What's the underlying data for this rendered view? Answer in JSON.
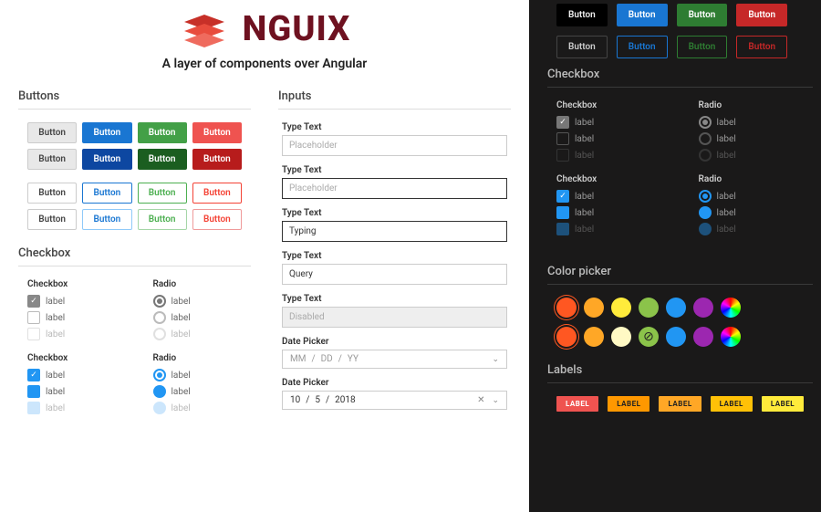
{
  "hero": {
    "brand": "NGUIX",
    "tagline": "A layer of components over Angular"
  },
  "sections": {
    "buttons": "Buttons",
    "inputs": "Inputs",
    "checkbox": "Checkbox",
    "colorpicker": "Color picker",
    "labels": "Labels"
  },
  "btn_label": "Button",
  "checkbox": {
    "head_cb": "Checkbox",
    "head_rd": "Radio",
    "label": "label"
  },
  "inputs": {
    "type_text": "Type Text",
    "placeholder": "Placeholder",
    "typing": "Typing",
    "query": "Query",
    "disabled": "Disabled",
    "date_picker": "Date Picker",
    "mm": "MM",
    "dd": "DD",
    "yy": "YY",
    "d1": "10",
    "d2": "5",
    "d3": "2018"
  },
  "label_text": "LABEL"
}
